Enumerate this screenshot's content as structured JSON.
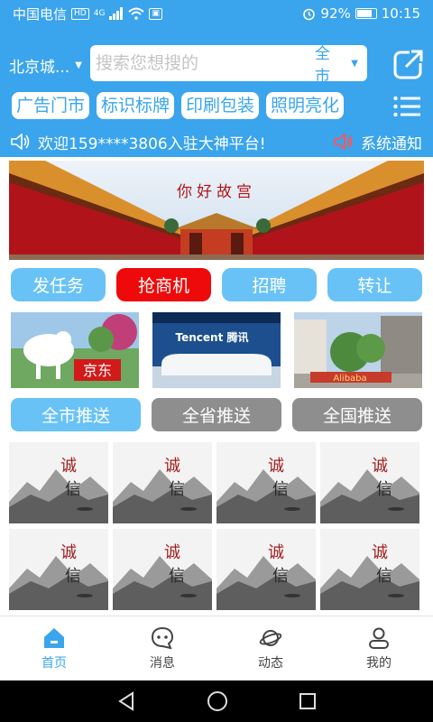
{
  "status_bar": {
    "carrier": "中国电信",
    "hd": "HD",
    "network": "4G",
    "battery_percent": "92%",
    "time": "10:15"
  },
  "header": {
    "city": "北京城...",
    "search_placeholder": "搜索您想搜的",
    "scope": "全市",
    "tags": [
      "广告门市",
      "标识标牌",
      "印刷包装",
      "照明亮化"
    ],
    "welcome": "欢迎159****3806入驻大神平台!",
    "system_notice": "系统通知"
  },
  "banner": {
    "text": "你好故宫"
  },
  "actions": [
    {
      "label": "发任务",
      "highlight": false
    },
    {
      "label": "抢商机",
      "highlight": true
    },
    {
      "label": "招聘",
      "highlight": false
    },
    {
      "label": "转让",
      "highlight": false
    }
  ],
  "logos": {
    "jd": "京东",
    "tencent": "Tencent 腾讯",
    "alibaba": "Alibaba"
  },
  "push": [
    {
      "label": "全市推送",
      "active": true
    },
    {
      "label": "全省推送",
      "active": false
    },
    {
      "label": "全国推送",
      "active": false
    }
  ],
  "cards": {
    "title_top": "诚",
    "title_bottom": "信"
  },
  "tabbar": [
    {
      "label": "首页",
      "icon": "home-icon",
      "active": true
    },
    {
      "label": "消息",
      "icon": "message-icon",
      "active": false
    },
    {
      "label": "动态",
      "icon": "planet-icon",
      "active": false
    },
    {
      "label": "我的",
      "icon": "user-icon",
      "active": false
    }
  ],
  "colors": {
    "primary": "#3aa4ec",
    "button_light": "#68c2f5",
    "button_red": "#ee0a0a",
    "button_gray": "#8e8e8e"
  }
}
